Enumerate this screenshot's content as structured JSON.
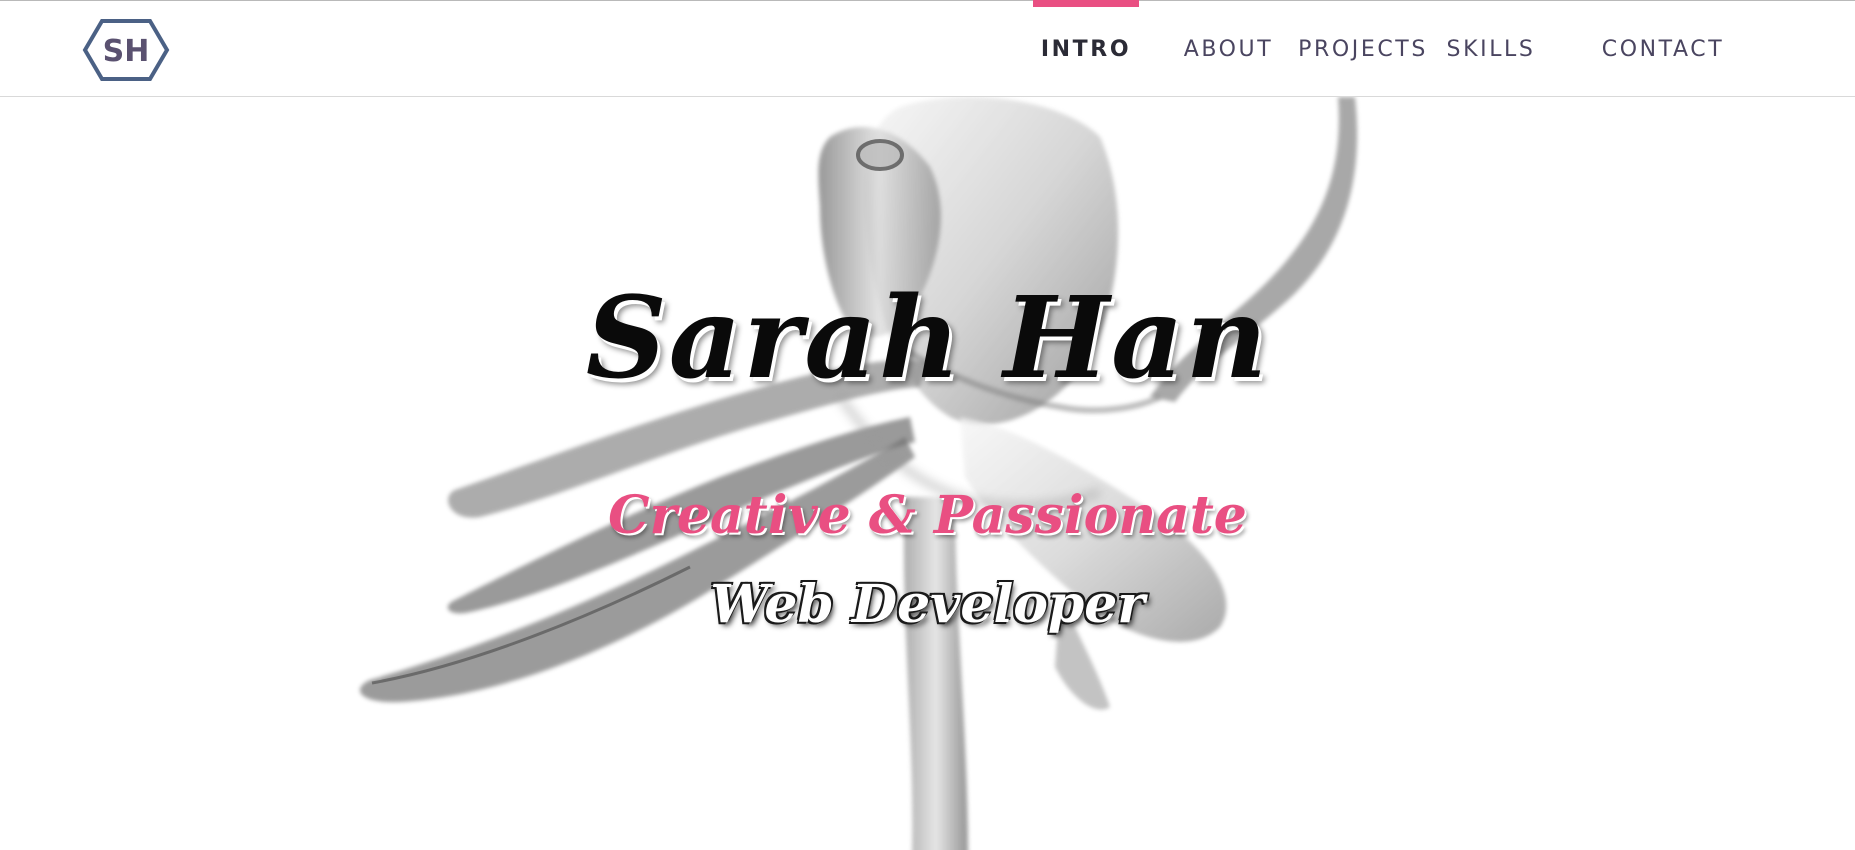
{
  "brand": {
    "logo_text": "SH",
    "logo_color": "#4b6185"
  },
  "nav": {
    "items": [
      {
        "label": "INTRO",
        "active": true
      },
      {
        "label": "ABOUT",
        "active": false
      },
      {
        "label": "PROJECTS",
        "active": false
      },
      {
        "label": "SKILLS",
        "active": false
      },
      {
        "label": "CONTACT",
        "active": false
      }
    ],
    "active_color": "#e94f82"
  },
  "hero": {
    "name": "Sarah Han",
    "subtitle": "Creative & Passionate",
    "role": "Web Developer",
    "background_image": "flower-xray-grayscale",
    "subtitle_color": "#e94f82"
  }
}
